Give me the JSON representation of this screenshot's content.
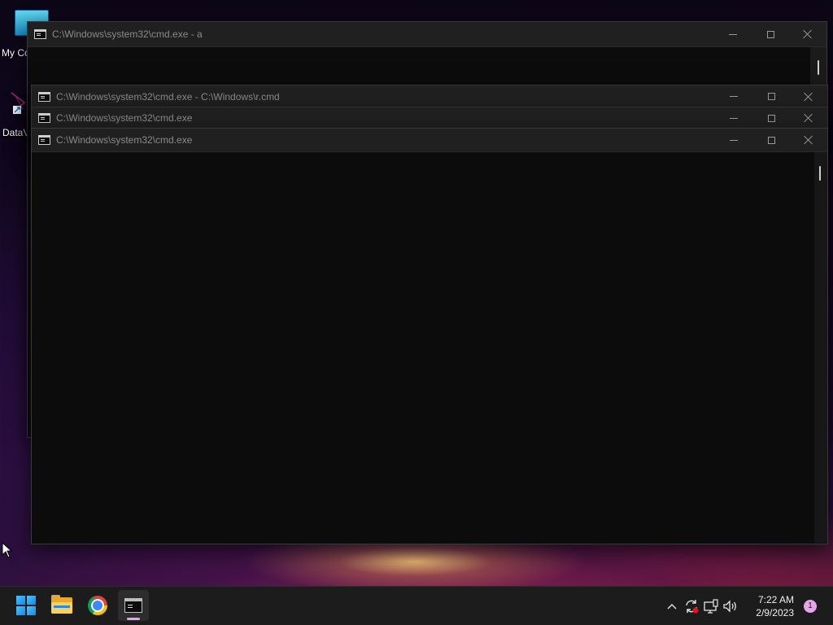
{
  "desktop": {
    "icons": [
      {
        "label": "My Co"
      },
      {
        "label": "DataV"
      }
    ]
  },
  "windows": [
    {
      "title": "C:\\Windows\\system32\\cmd.exe - a",
      "state": "background"
    },
    {
      "title": "C:\\Windows\\system32\\cmd.exe - C:\\Windows\\r.cmd",
      "state": "background"
    },
    {
      "title": "C:\\Windows\\system32\\cmd.exe",
      "state": "background"
    },
    {
      "title": "C:\\Windows\\system32\\cmd.exe",
      "state": "foreground"
    }
  ],
  "taskbar": {
    "apps": [
      "start",
      "file-explorer",
      "chrome",
      "command-prompt"
    ],
    "active_app": "command-prompt",
    "clock": {
      "time": "7:22 AM",
      "date": "2/9/2023"
    },
    "notification_count": "1"
  },
  "colors": {
    "console_bg": "#0c0c0c",
    "titlebar_bg": "#202020",
    "taskbar_bg": "#1c1c1c",
    "accent_pink": "#e5a4ec"
  }
}
